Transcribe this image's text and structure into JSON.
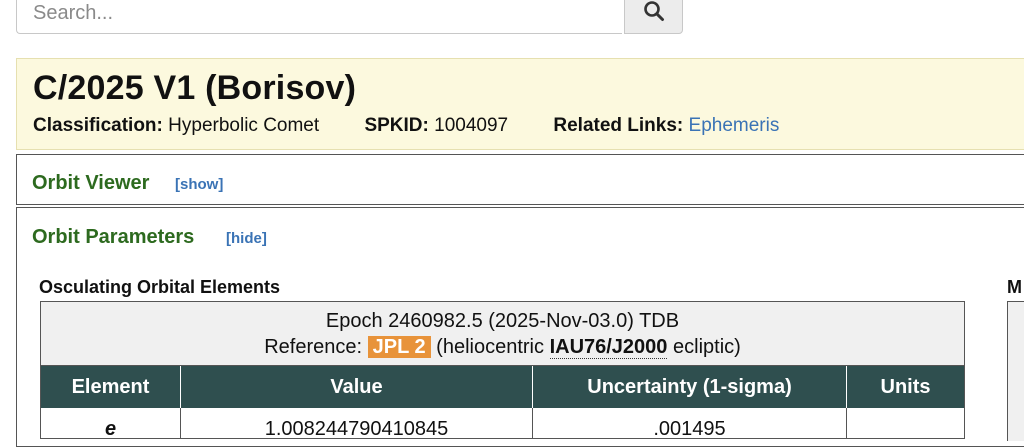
{
  "search": {
    "placeholder": "Search...",
    "icon": "search-icon"
  },
  "object": {
    "title": "C/2025 V1 (Borisov)",
    "classification_label": "Classification:",
    "classification_value": "Hyperbolic Comet",
    "spkid_label": "SPKID:",
    "spkid_value": "1004097",
    "related_links_label": "Related Links:",
    "related_links_value": "Ephemeris"
  },
  "orbit_viewer": {
    "title": "Orbit Viewer",
    "toggle": "[show]"
  },
  "orbit_parameters": {
    "title": "Orbit Parameters",
    "toggle": "[hide]",
    "subheading": "Osculating Orbital Elements",
    "right_heading": "M",
    "right_stub_dash": "-",
    "epoch_line": "Epoch 2460982.5 (2025-Nov-03.0) TDB",
    "reference_label": "Reference:",
    "reference_badge": "JPL 2",
    "reference_pre": "(heliocentric",
    "reference_frame": "IAU76/J2000",
    "reference_post": "ecliptic)",
    "columns": [
      "Element",
      "Value",
      "Uncertainty (1-sigma)",
      "Units"
    ],
    "rows": [
      {
        "element": "e",
        "value": "1.008244790410845",
        "uncertainty": ".001495",
        "units": ""
      }
    ]
  },
  "colors": {
    "header_bg": "#fcf9de",
    "section_title": "#2d6a1f",
    "link": "#3a73b5",
    "table_header_bg": "#2f4f4f",
    "badge": "#e8933a"
  }
}
